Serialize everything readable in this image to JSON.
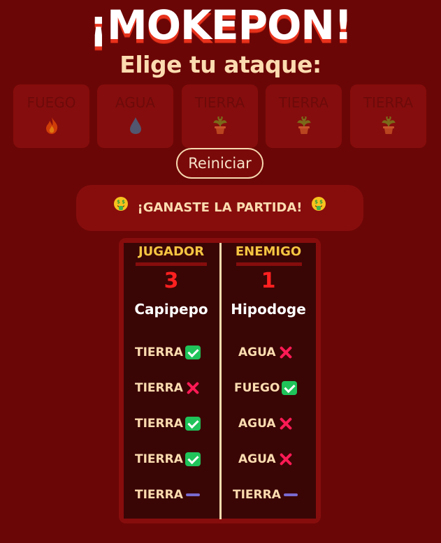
{
  "title": "¡MOKEPON!",
  "subtitle": "Elige tu ataque:",
  "attacks": [
    {
      "label": "FUEGO",
      "icon": "fire-icon"
    },
    {
      "label": "AGUA",
      "icon": "water-drop-icon"
    },
    {
      "label": "TIERRA",
      "icon": "potted-plant-icon"
    },
    {
      "label": "TIERRA",
      "icon": "potted-plant-icon"
    },
    {
      "label": "TIERRA",
      "icon": "potted-plant-icon"
    }
  ],
  "restart_label": "Reiniciar",
  "result": {
    "text": "¡GANASTE LA PARTIDA!",
    "emoji": "money-mouth-face-icon"
  },
  "player": {
    "header": "JUGADOR",
    "score": "3",
    "pet": "Capipepo",
    "attacks": [
      {
        "label": "TIERRA",
        "mark": "win"
      },
      {
        "label": "TIERRA",
        "mark": "lose"
      },
      {
        "label": "TIERRA",
        "mark": "win"
      },
      {
        "label": "TIERRA",
        "mark": "win"
      },
      {
        "label": "TIERRA",
        "mark": "tie"
      }
    ]
  },
  "enemy": {
    "header": "ENEMIGO",
    "score": "1",
    "pet": "Hipodoge",
    "attacks": [
      {
        "label": "AGUA",
        "mark": "lose"
      },
      {
        "label": "FUEGO",
        "mark": "win"
      },
      {
        "label": "AGUA",
        "mark": "lose"
      },
      {
        "label": "AGUA",
        "mark": "lose"
      },
      {
        "label": "TIERRA",
        "mark": "tie"
      }
    ]
  },
  "colors": {
    "background": "#6b0606",
    "panel": "#870d0d",
    "accent_cream": "#fbdcb0",
    "header_yellow": "#f5c542",
    "score_red": "#ff2020",
    "win_green": "#1fc35a",
    "lose_pink": "#ff1a55",
    "tie_purple": "#7a6ad0"
  }
}
